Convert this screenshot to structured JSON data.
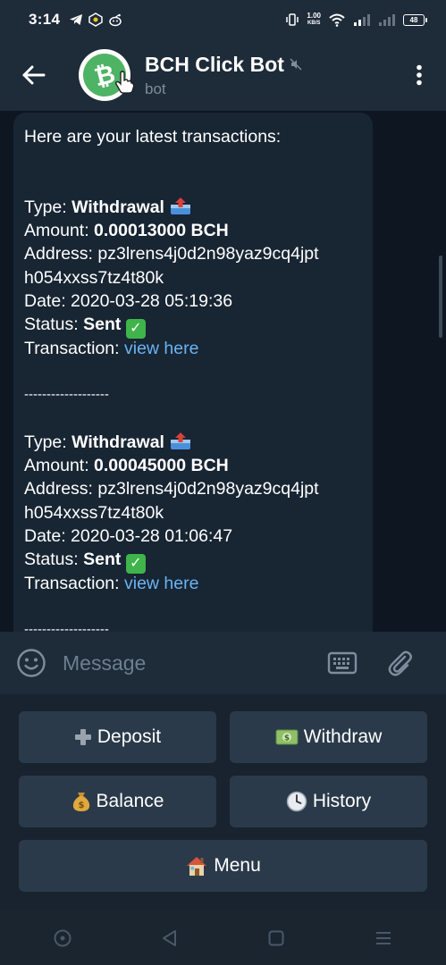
{
  "status_bar": {
    "time": "3:14",
    "net_speed_value": "1.00",
    "net_speed_unit": "KB/S",
    "battery": "48"
  },
  "header": {
    "bot_name": "BCH Click Bot",
    "bot_status": "bot"
  },
  "message": {
    "intro": "Here are your latest transactions:",
    "labels": {
      "type": "Type: ",
      "amount": "Amount: ",
      "address": "Address: ",
      "date": "Date: ",
      "status": "Status: ",
      "transaction": "Transaction: "
    },
    "separator": "-------------------",
    "transactions": [
      {
        "type": "Withdrawal",
        "amount": "0.00013000 BCH",
        "address_line1": "pz3lrens4j0d2n98yaz9cq4jpt",
        "address_line2": "h054xxss7tz4t80k",
        "date": "2020-03-28 05:19:36",
        "status": "Sent",
        "link": "view here"
      },
      {
        "type": "Withdrawal",
        "amount": "0.00045000 BCH",
        "address_line1": "pz3lrens4j0d2n98yaz9cq4jpt",
        "address_line2": "h054xxss7tz4t80k",
        "date": "2020-03-28 01:06:47",
        "status": "Sent",
        "link": "view here"
      }
    ]
  },
  "input": {
    "placeholder": "Message"
  },
  "keyboard": {
    "deposit": "Deposit",
    "withdraw": "Withdraw",
    "balance": "Balance",
    "history": "History",
    "menu": "Menu"
  },
  "colors": {
    "header_bg": "#1e2b39",
    "chat_bg": "#0e1621",
    "bubble_bg": "#182533",
    "link": "#6ab3f3",
    "button_bg": "#2a3a4a"
  }
}
